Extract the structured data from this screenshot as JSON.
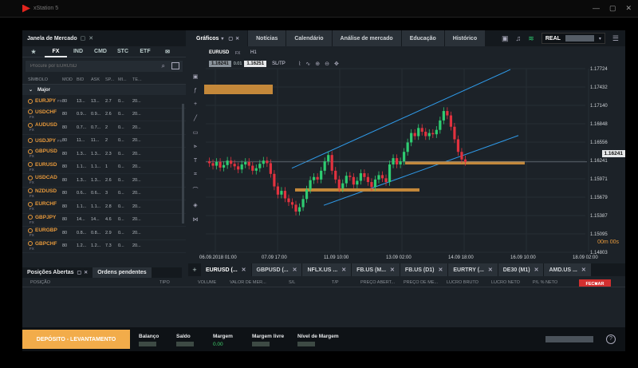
{
  "window": {
    "app_title": "xStation 5",
    "controls": [
      "—",
      "▢",
      "✕"
    ]
  },
  "market_watch": {
    "title": "Janela de Mercado",
    "tabs": [
      "★",
      "FX",
      "IND",
      "CMD",
      "STC",
      "ETF",
      "✉"
    ],
    "active_tab": "FX",
    "search_placeholder": "Procure por EURUSD",
    "columns": [
      "SÍMBOLO",
      "MOD",
      "BID",
      "ASK",
      "SP...",
      "MI...",
      "TE..."
    ],
    "group": "Major",
    "rows": [
      {
        "symbol": "EURJPY",
        "type": "FX",
        "mod": "80",
        "bid": "13...",
        "ask": "13...",
        "sp": "2.7",
        "mi": "0...",
        "te": "20..."
      },
      {
        "symbol": "USDCHF",
        "type": "FX",
        "mod": "80",
        "bid": "0.9...",
        "ask": "0.9...",
        "sp": "2.6",
        "mi": "0...",
        "te": "20..."
      },
      {
        "symbol": "AUDUSD",
        "type": "FX",
        "mod": "80",
        "bid": "0.7...",
        "ask": "0.7...",
        "sp": "2",
        "mi": "0...",
        "te": "20..."
      },
      {
        "symbol": "USDJPY",
        "type": "FX",
        "mod": "80",
        "bid": "11...",
        "ask": "11...",
        "sp": "2",
        "mi": "0...",
        "te": "20..."
      },
      {
        "symbol": "GBPUSD",
        "type": "FX",
        "mod": "80",
        "bid": "1.3...",
        "ask": "1.3...",
        "sp": "2.3",
        "mi": "0...",
        "te": "20..."
      },
      {
        "symbol": "EURUSD",
        "type": "FX",
        "mod": "80",
        "bid": "1.1...",
        "ask": "1.1...",
        "sp": "1",
        "mi": "0...",
        "te": "20..."
      },
      {
        "symbol": "USDCAD",
        "type": "FX",
        "mod": "80",
        "bid": "1.3...",
        "ask": "1.3...",
        "sp": "2.6",
        "mi": "0...",
        "te": "20..."
      },
      {
        "symbol": "NZDUSD",
        "type": "FX",
        "mod": "80",
        "bid": "0.6...",
        "ask": "0.6...",
        "sp": "3",
        "mi": "0...",
        "te": "20..."
      },
      {
        "symbol": "EURCHF",
        "type": "FX",
        "mod": "80",
        "bid": "1.1...",
        "ask": "1.1...",
        "sp": "2.8",
        "mi": "0...",
        "te": "20..."
      },
      {
        "symbol": "GBPJPY",
        "type": "FX",
        "mod": "80",
        "bid": "14...",
        "ask": "14...",
        "sp": "4.6",
        "mi": "0...",
        "te": "20..."
      },
      {
        "symbol": "EURGBP",
        "type": "FX",
        "mod": "80",
        "bid": "0.8...",
        "ask": "0.8...",
        "sp": "2.9",
        "mi": "0...",
        "te": "20..."
      },
      {
        "symbol": "GBPCHF",
        "type": "FX",
        "mod": "80",
        "bid": "1.2...",
        "ask": "1.2...",
        "sp": "7.3",
        "mi": "0...",
        "te": "20..."
      }
    ]
  },
  "top_tabs": [
    "Gráficos",
    "Notícias",
    "Calendário",
    "Análise de mercado",
    "Educação",
    "Histórico"
  ],
  "account_type": "REAL",
  "chart": {
    "symbol": "EURUSD",
    "symbol_type": "FX",
    "timeframe": "H1",
    "bid": "1.16241",
    "spread": "0.01",
    "ask": "1.16251",
    "sltp": "SL/TP",
    "current_price": "1.16241",
    "countdown": "00m 00s"
  },
  "chart_data": {
    "type": "candlestick",
    "symbol": "EURUSD",
    "y_ticks": [
      "1.17724",
      "1.17432",
      "1.17140",
      "1.16848",
      "1.16556",
      "1.16241",
      "1.15971",
      "1.15679",
      "1.15387",
      "1.15095",
      "1.14803"
    ],
    "x_ticks": [
      "06.09.2018 01:00",
      "07.09 17:00",
      "11.09 10:00",
      "13.09 02:00",
      "14.09 18:00",
      "16.09 10:00",
      "18.09 02:00"
    ],
    "ylim": [
      1.14803,
      1.17724
    ],
    "close_path": [
      1.1625,
      1.1622,
      1.1618,
      1.1624,
      1.1615,
      1.1619,
      1.1626,
      1.1621,
      1.1617,
      1.1612,
      1.162,
      1.1624,
      1.1618,
      1.161,
      1.1614,
      1.1621,
      1.1626,
      1.1622,
      1.1605,
      1.1585,
      1.1572,
      1.1578,
      1.1566,
      1.156,
      1.1556,
      1.1545,
      1.1552,
      1.1565,
      1.158,
      1.1595,
      1.16,
      1.1596,
      1.161,
      1.1625,
      1.1635,
      1.161,
      1.1596,
      1.1582,
      1.159,
      1.1602,
      1.16,
      1.1588,
      1.1594,
      1.1606,
      1.16,
      1.1592,
      1.1584,
      1.1596,
      1.1603,
      1.1598,
      1.1592,
      1.162,
      1.163,
      1.162,
      1.1625,
      1.164,
      1.1655,
      1.167,
      1.1665,
      1.1678,
      1.1672,
      1.1665,
      1.167,
      1.1668,
      1.1675,
      1.169,
      1.1705,
      1.1698,
      1.168,
      1.166,
      1.164,
      1.1628,
      1.1624
    ]
  },
  "symbol_tabs": [
    "EURUSD (...",
    "GBPUSD (...",
    "NFLX.US ...",
    "FB.US (M...",
    "FB.US (D1)",
    "EURTRY (...",
    "DE30 (M1)",
    "AMD.US ..."
  ],
  "positions": {
    "tabs": [
      "Posições Abertas",
      "Ordens pendentes"
    ],
    "columns": [
      "POSIÇÃO",
      "TIPO",
      "VOLUME",
      "VALOR DE MER...",
      "S/L",
      "T/P",
      "PREÇO ABERT...",
      "PREÇO DE ME...",
      "LUCRO BRUTO",
      "LUCRO NETO",
      "P/L % NETO"
    ],
    "close_label": "FECHAR"
  },
  "bottom": {
    "deposit_label": "DEPÓSITO - LEVANTAMENTO",
    "items": [
      {
        "label": "Balanço",
        "value": ""
      },
      {
        "label": "Saldo",
        "value": ""
      },
      {
        "label": "Margem",
        "value": "0.00"
      },
      {
        "label": "Margem livre",
        "value": ""
      },
      {
        "label": "Nível de Margem",
        "value": ""
      }
    ],
    "help": "?"
  },
  "colors": {
    "accent": "#e89a3c",
    "up": "#2ecc71",
    "down": "#e2323f",
    "channel": "#2f9bea",
    "zone": "#c4883a",
    "close": "#d22f2f"
  }
}
